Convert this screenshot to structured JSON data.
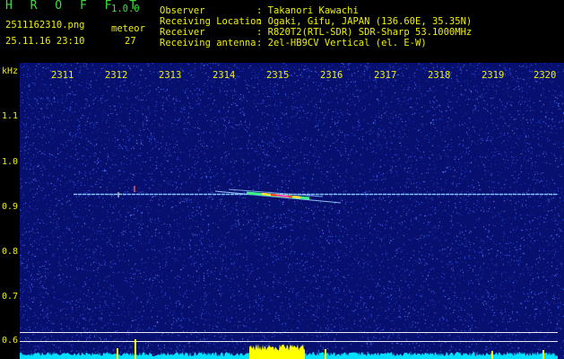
{
  "header": {
    "app_name": "H R O F F T",
    "version": "1.0.0",
    "filename": "2511162310.png",
    "datetime": "25.11.16 23:10",
    "event_label": "meteor",
    "event_count": "27"
  },
  "station": {
    "rows": [
      {
        "label": "Observer",
        "value": ": Takanori Kawachi"
      },
      {
        "label": "Receiving Location",
        "value": ": Ogaki, Gifu, JAPAN (136.60E, 35.35N)"
      },
      {
        "label": "Receiver",
        "value": ": R820T2(RTL-SDR) SDR-Sharp 53.1000MHz"
      },
      {
        "label": "Receiving antenna",
        "value": ": 2el-HB9CV Vertical (el. E-W)"
      }
    ]
  },
  "axis": {
    "y_unit": "kHz",
    "time_ticks": [
      "2311",
      "2312",
      "2313",
      "2314",
      "2315",
      "2316",
      "2317",
      "2318",
      "2319",
      "2320"
    ],
    "freq_ticks": [
      "1.1",
      "1.0",
      "0.9",
      "0.8",
      "0.7",
      "0.6"
    ]
  },
  "colors": {
    "background": "#07106e",
    "noise": "#4060ff",
    "label_yellow": "#f0f000",
    "label_green": "#38e038",
    "level_cyan": "#00e0ff",
    "level_yellow": "#ffff00"
  }
}
